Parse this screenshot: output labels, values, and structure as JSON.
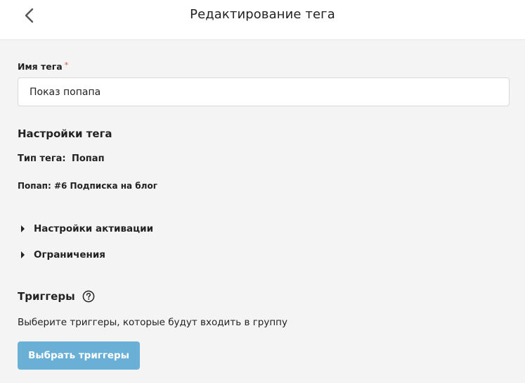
{
  "header": {
    "title": "Редактирование тега"
  },
  "form": {
    "tag_name_label": "Имя тега",
    "required_mark": "*",
    "tag_name_value": "Показ попапа"
  },
  "settings": {
    "title": "Настройки тега",
    "type_label": "Тип тега:",
    "type_value": "Попап",
    "popup_line": "Попап: #6 Подписка на блог",
    "sections": [
      {
        "label": "Настройки активации"
      },
      {
        "label": "Ограничения"
      }
    ]
  },
  "triggers": {
    "title": "Триггеры",
    "description": "Выберите триггеры, которые будут входить в группу",
    "button_label": "Выбрать триггеры"
  },
  "colors": {
    "accent_button": "#6aafd6",
    "required": "#e44b4b"
  }
}
